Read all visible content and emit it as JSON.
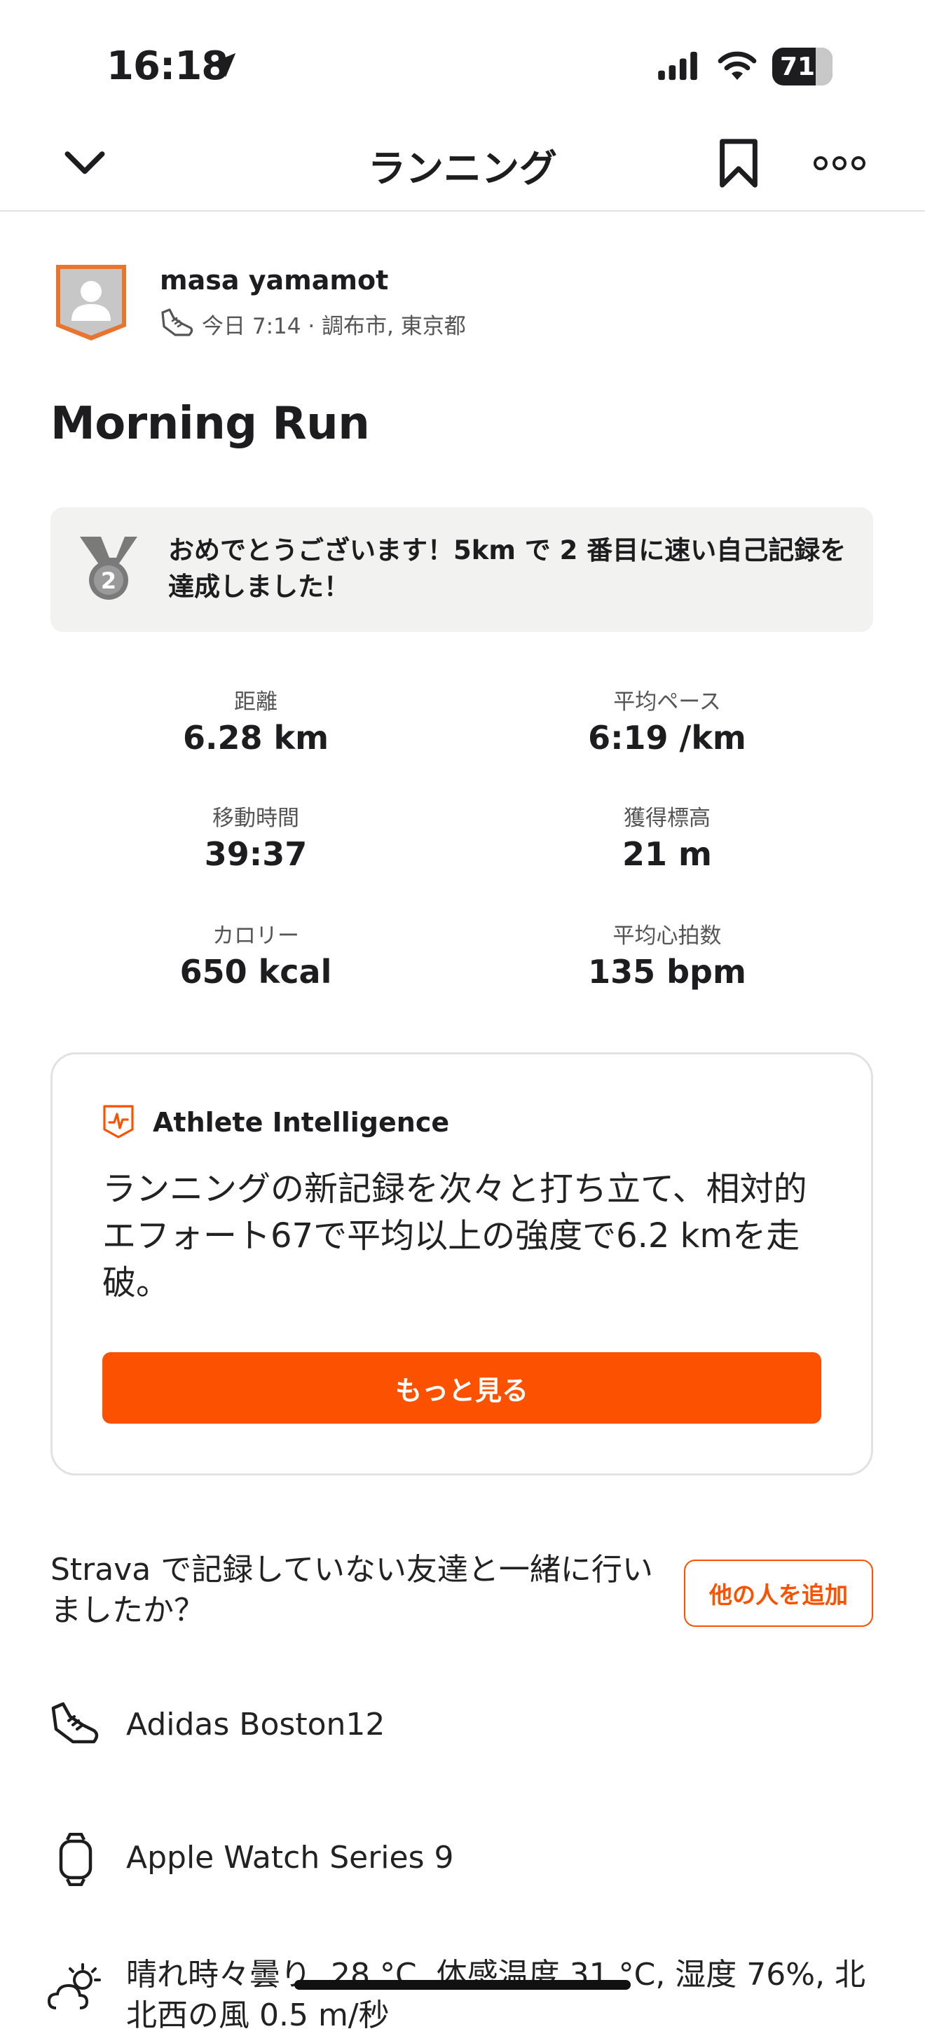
{
  "status_bar": {
    "time": "16:18",
    "battery": "71"
  },
  "header": {
    "title": "ランニング"
  },
  "athlete": {
    "name": "masa yamamot",
    "meta": "今日 7:14 · 調布市, 東京都"
  },
  "activity": {
    "title": "Morning Run"
  },
  "achievement": {
    "medal_rank": "2",
    "text": "おめでとうございます！5km で 2 番目に速い自己記録を達成しました！"
  },
  "stats": [
    {
      "label": "距離",
      "value": "6.28 km"
    },
    {
      "label": "平均ペース",
      "value": "6:19 /km"
    },
    {
      "label": "移動時間",
      "value": "39:37"
    },
    {
      "label": "獲得標高",
      "value": "21 m"
    },
    {
      "label": "カロリー",
      "value": "650 kcal"
    },
    {
      "label": "平均心拍数",
      "value": "135 bpm"
    }
  ],
  "athlete_intelligence": {
    "title": "Athlete Intelligence",
    "text": "ランニングの新記録を次々と打ち立て、相対的エフォート67で平均以上の強度で6.2 kmを走破。",
    "button": "もっと見る"
  },
  "friends": {
    "question": "Strava で記録していない友達と一緒に行いましたか？",
    "add_button": "他の人を追加"
  },
  "gear": {
    "shoes": "Adidas Boston12",
    "device": "Apple Watch Series 9"
  },
  "weather": {
    "text": "晴れ時々曇り, 28 °C, 体感温度 31 °C, 湿度 76%, 北北西の風 0.5 m/秒"
  },
  "colors": {
    "accent": "#fc5200",
    "text": "#1d1d1f",
    "muted": "#555555",
    "card_bg": "#f2f2f0",
    "border": "#e2e2e2"
  },
  "icons": [
    "location-arrow-icon",
    "signal-icon",
    "wifi-icon",
    "battery-icon",
    "chevron-down-icon",
    "bookmark-icon",
    "more-icon",
    "avatar-icon",
    "shoe-icon",
    "medal-icon",
    "athlete-intelligence-icon",
    "watch-icon",
    "weather-icon"
  ]
}
